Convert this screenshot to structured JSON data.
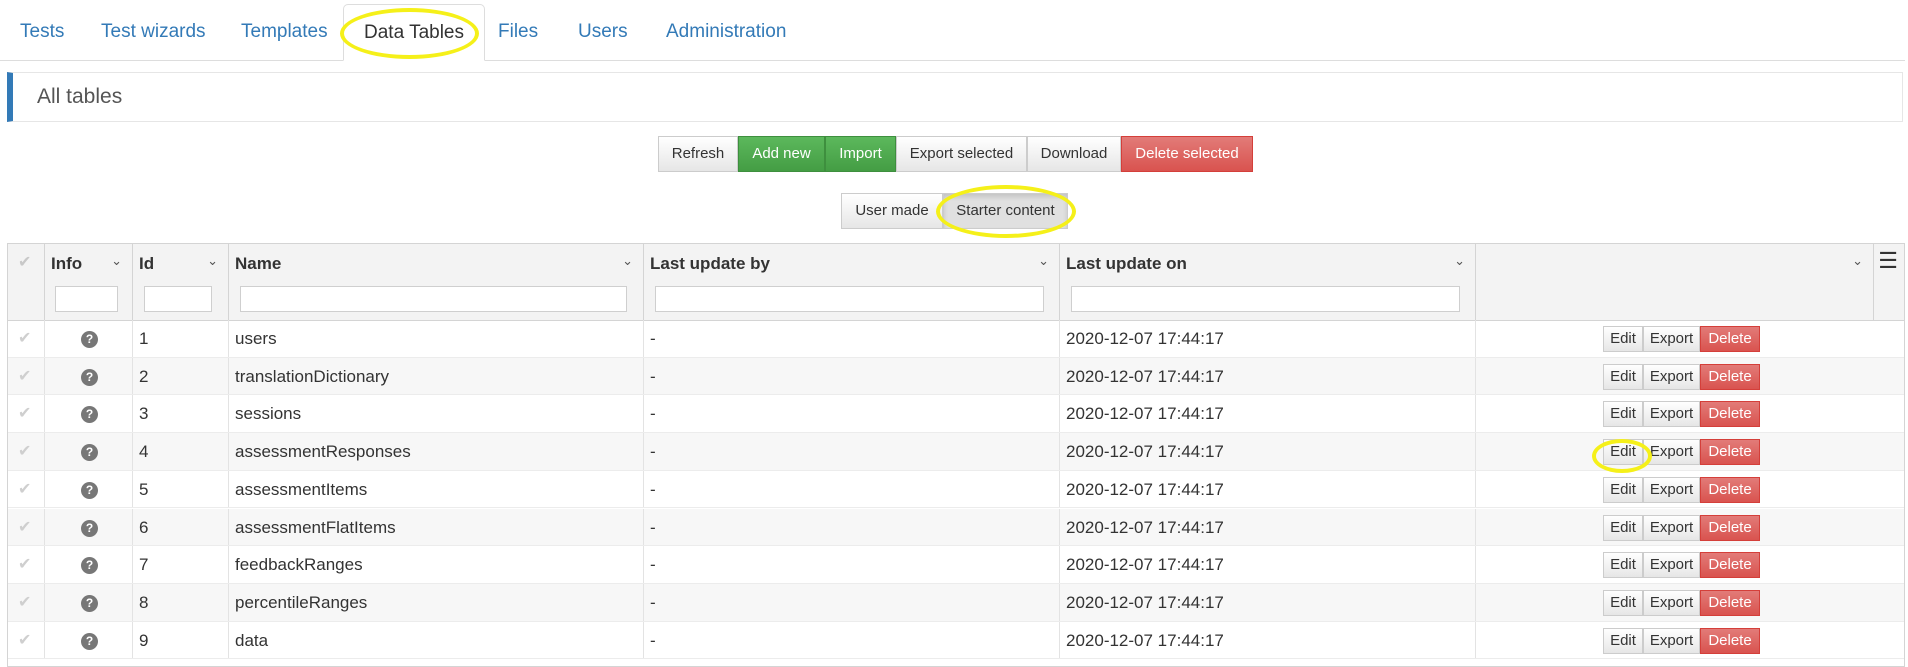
{
  "tabs": [
    {
      "label": "Tests"
    },
    {
      "label": "Test wizards"
    },
    {
      "label": "Templates"
    },
    {
      "label": "Data Tables",
      "active": true
    },
    {
      "label": "Files"
    },
    {
      "label": "Users"
    },
    {
      "label": "Administration"
    }
  ],
  "panel": {
    "title": "All tables"
  },
  "toolbar": {
    "refresh": "Refresh",
    "add_new": "Add new",
    "import": "Import",
    "export_selected": "Export selected",
    "download": "Download",
    "delete_selected": "Delete selected"
  },
  "filter": {
    "user_made": "User made",
    "starter_content": "Starter content"
  },
  "grid": {
    "columns": {
      "info": "Info",
      "id": "Id",
      "name": "Name",
      "last_update_by": "Last update by",
      "last_update_on": "Last update on"
    },
    "actions": {
      "edit": "Edit",
      "export": "Export",
      "delete": "Delete"
    },
    "rows": [
      {
        "id": "1",
        "name": "users",
        "updated_by": "-",
        "updated_on": "2020-12-07 17:44:17"
      },
      {
        "id": "2",
        "name": "translationDictionary",
        "updated_by": "-",
        "updated_on": "2020-12-07 17:44:17"
      },
      {
        "id": "3",
        "name": "sessions",
        "updated_by": "-",
        "updated_on": "2020-12-07 17:44:17"
      },
      {
        "id": "4",
        "name": "assessmentResponses",
        "updated_by": "-",
        "updated_on": "2020-12-07 17:44:17"
      },
      {
        "id": "5",
        "name": "assessmentItems",
        "updated_by": "-",
        "updated_on": "2020-12-07 17:44:17"
      },
      {
        "id": "6",
        "name": "assessmentFlatItems",
        "updated_by": "-",
        "updated_on": "2020-12-07 17:44:17"
      },
      {
        "id": "7",
        "name": "feedbackRanges",
        "updated_by": "-",
        "updated_on": "2020-12-07 17:44:17"
      },
      {
        "id": "8",
        "name": "percentileRanges",
        "updated_by": "-",
        "updated_on": "2020-12-07 17:44:17"
      },
      {
        "id": "9",
        "name": "data",
        "updated_by": "-",
        "updated_on": "2020-12-07 17:44:17"
      }
    ]
  },
  "icons": {
    "info": "question-circle-icon",
    "check": "check-icon",
    "column_menu": "chevron-down-icon",
    "grid_menu": "hamburger-menu-icon"
  },
  "colors": {
    "link": "#337ab7",
    "success": "#5cb85c",
    "danger": "#d9534f",
    "highlight": "#f5f019"
  }
}
